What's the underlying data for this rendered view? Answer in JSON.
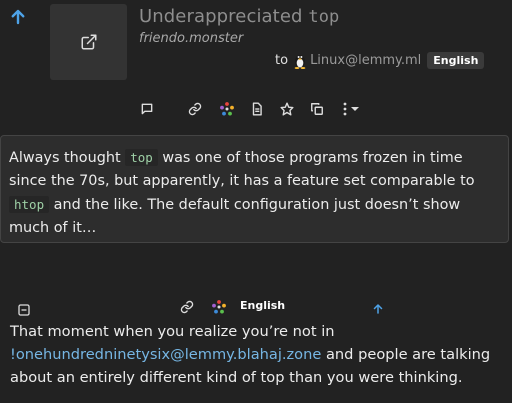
{
  "post": {
    "title_prefix": "Underappreciated ",
    "title_code": "top",
    "domain": "friendo.monster",
    "to_label": "to",
    "community": "Linux@lemmy.ml",
    "language": "English",
    "body": {
      "text1": "Always thought ",
      "code1": "top",
      "text2": " was one of those programs frozen in time since the 70s, but apparently, it has a feature set comparable to ",
      "code2": "htop",
      "text3": " and the like. The default configuration just doesn’t show much of it…"
    }
  },
  "comment": {
    "language": "English",
    "text1": "That moment when you realize you’re not in ",
    "link": "!onehundredninetysix@lemmy.blahaj.zone",
    "text2": " and people are talking about an entirely different kind of top than you were thinking."
  },
  "icons": [
    "arrow-up-icon",
    "external-link-icon",
    "tux-icon",
    "comment-icon",
    "link-icon",
    "fediverse-icon",
    "document-icon",
    "star-icon",
    "copy-icon",
    "more-icon",
    "caret-down-icon",
    "collapse-icon"
  ],
  "colors": {
    "background": "#222222",
    "upvote": "#4ea3e8",
    "link": "#76b6e4",
    "badge": "#3a3a3a"
  }
}
